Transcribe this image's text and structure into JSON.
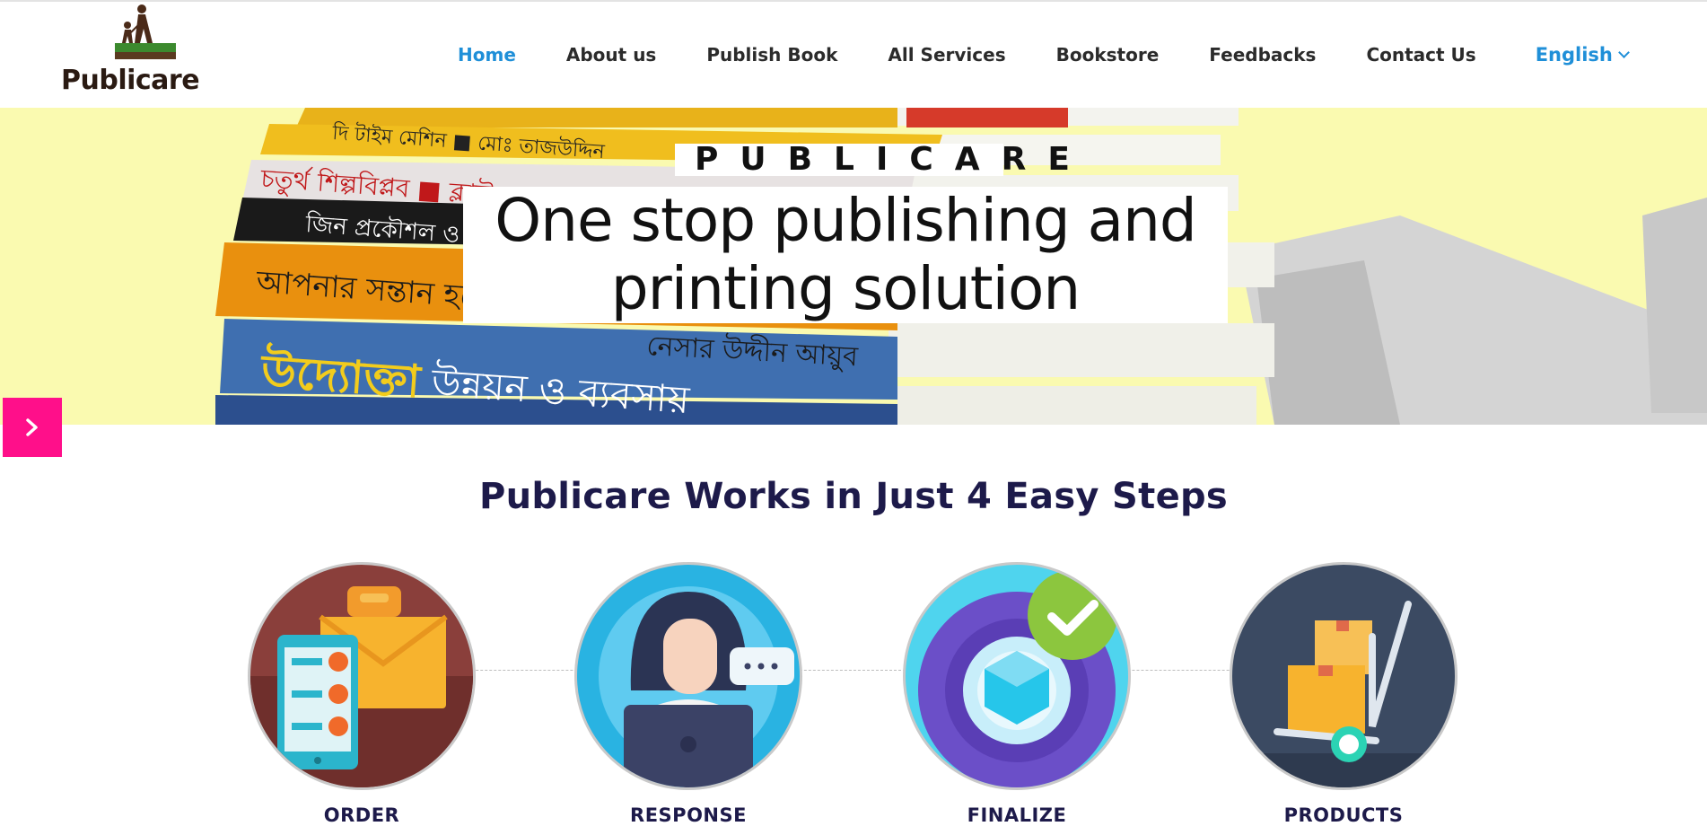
{
  "brand": {
    "name": "Publicare"
  },
  "nav": {
    "items": [
      {
        "label": "Home",
        "active": true
      },
      {
        "label": "About us"
      },
      {
        "label": "Publish Book"
      },
      {
        "label": "All Services"
      },
      {
        "label": "Bookstore"
      },
      {
        "label": "Feedbacks"
      },
      {
        "label": "Contact Us"
      }
    ],
    "language": "English"
  },
  "hero": {
    "kicker": "PUBLICARE",
    "title_line1": "One stop publishing and",
    "title_line2": "printing solution",
    "book_spines": [
      "দি টাইম মেশিন ■ মোঃ তাজউদ্দিন",
      "চতুর্থ শিল্পবিপ্লব ■ ক্লাউস",
      "জিন প্রকৌশল ও",
      "আপনার সন্তান হবে",
      "উদ্যোক্তা উন্নয়ন ও ব্যবসায় নির্দেশনা",
      "নেসার উদ্দীন আয়ুব"
    ]
  },
  "steps": {
    "title": "Publicare Works in Just 4 Easy Steps",
    "items": [
      {
        "label": "ORDER",
        "icon": "order-icon"
      },
      {
        "label": "RESPONSE",
        "icon": "support-agent-icon"
      },
      {
        "label": "FINALIZE",
        "icon": "finalize-gear-icon"
      },
      {
        "label": "PRODUCTS",
        "icon": "delivery-trolley-icon"
      }
    ]
  },
  "colors": {
    "accent": "#1f8fd8",
    "slider_button": "#ff0f8a",
    "hero_bg": "#fafab0",
    "heading": "#1d1a4a"
  }
}
